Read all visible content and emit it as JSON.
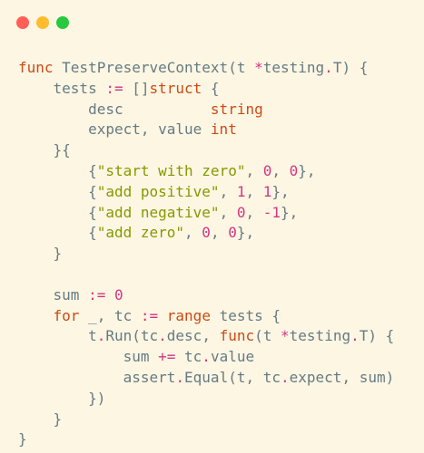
{
  "window": {
    "controls": [
      "close",
      "minimize",
      "maximize"
    ]
  },
  "code": {
    "lines": [
      [
        {
          "t": "kw",
          "v": "func"
        },
        {
          "t": "plain",
          "v": " TestPreserveContext(t "
        },
        {
          "t": "op",
          "v": "*"
        },
        {
          "t": "plain",
          "v": "testing"
        },
        {
          "t": "op",
          "v": "."
        },
        {
          "t": "plain",
          "v": "T) {"
        }
      ],
      [
        {
          "t": "plain",
          "v": "    tests "
        },
        {
          "t": "op",
          "v": ":="
        },
        {
          "t": "plain",
          "v": " []"
        },
        {
          "t": "kw",
          "v": "struct"
        },
        {
          "t": "plain",
          "v": " {"
        }
      ],
      [
        {
          "t": "plain",
          "v": "        desc          "
        },
        {
          "t": "ty",
          "v": "string"
        }
      ],
      [
        {
          "t": "plain",
          "v": "        expect, value "
        },
        {
          "t": "ty",
          "v": "int"
        }
      ],
      [
        {
          "t": "plain",
          "v": "    }{"
        }
      ],
      [
        {
          "t": "plain",
          "v": "        {"
        },
        {
          "t": "str",
          "v": "\"start with zero\""
        },
        {
          "t": "plain",
          "v": ", "
        },
        {
          "t": "num",
          "v": "0"
        },
        {
          "t": "plain",
          "v": ", "
        },
        {
          "t": "num",
          "v": "0"
        },
        {
          "t": "plain",
          "v": "},"
        }
      ],
      [
        {
          "t": "plain",
          "v": "        {"
        },
        {
          "t": "str",
          "v": "\"add positive\""
        },
        {
          "t": "plain",
          "v": ", "
        },
        {
          "t": "num",
          "v": "1"
        },
        {
          "t": "plain",
          "v": ", "
        },
        {
          "t": "num",
          "v": "1"
        },
        {
          "t": "plain",
          "v": "},"
        }
      ],
      [
        {
          "t": "plain",
          "v": "        {"
        },
        {
          "t": "str",
          "v": "\"add negative\""
        },
        {
          "t": "plain",
          "v": ", "
        },
        {
          "t": "num",
          "v": "0"
        },
        {
          "t": "plain",
          "v": ", "
        },
        {
          "t": "num",
          "v": "-1"
        },
        {
          "t": "plain",
          "v": "},"
        }
      ],
      [
        {
          "t": "plain",
          "v": "        {"
        },
        {
          "t": "str",
          "v": "\"add zero\""
        },
        {
          "t": "plain",
          "v": ", "
        },
        {
          "t": "num",
          "v": "0"
        },
        {
          "t": "plain",
          "v": ", "
        },
        {
          "t": "num",
          "v": "0"
        },
        {
          "t": "plain",
          "v": "},"
        }
      ],
      [
        {
          "t": "plain",
          "v": "    }"
        }
      ],
      [
        {
          "t": "plain",
          "v": ""
        }
      ],
      [
        {
          "t": "plain",
          "v": "    sum "
        },
        {
          "t": "op",
          "v": ":="
        },
        {
          "t": "plain",
          "v": " "
        },
        {
          "t": "num",
          "v": "0"
        }
      ],
      [
        {
          "t": "plain",
          "v": "    "
        },
        {
          "t": "kw",
          "v": "for"
        },
        {
          "t": "plain",
          "v": " _, tc "
        },
        {
          "t": "op",
          "v": ":="
        },
        {
          "t": "plain",
          "v": " "
        },
        {
          "t": "kw",
          "v": "range"
        },
        {
          "t": "plain",
          "v": " tests {"
        }
      ],
      [
        {
          "t": "plain",
          "v": "        t"
        },
        {
          "t": "op",
          "v": "."
        },
        {
          "t": "plain",
          "v": "Run(tc"
        },
        {
          "t": "op",
          "v": "."
        },
        {
          "t": "plain",
          "v": "desc, "
        },
        {
          "t": "kw",
          "v": "func"
        },
        {
          "t": "plain",
          "v": "(t "
        },
        {
          "t": "op",
          "v": "*"
        },
        {
          "t": "plain",
          "v": "testing"
        },
        {
          "t": "op",
          "v": "."
        },
        {
          "t": "plain",
          "v": "T) {"
        }
      ],
      [
        {
          "t": "plain",
          "v": "            sum "
        },
        {
          "t": "op",
          "v": "+="
        },
        {
          "t": "plain",
          "v": " tc"
        },
        {
          "t": "op",
          "v": "."
        },
        {
          "t": "plain",
          "v": "value"
        }
      ],
      [
        {
          "t": "plain",
          "v": "            assert"
        },
        {
          "t": "op",
          "v": "."
        },
        {
          "t": "plain",
          "v": "Equal(t, tc"
        },
        {
          "t": "op",
          "v": "."
        },
        {
          "t": "plain",
          "v": "expect, sum)"
        }
      ],
      [
        {
          "t": "plain",
          "v": "        })"
        }
      ],
      [
        {
          "t": "plain",
          "v": "    }"
        }
      ],
      [
        {
          "t": "plain",
          "v": "}"
        }
      ]
    ]
  }
}
